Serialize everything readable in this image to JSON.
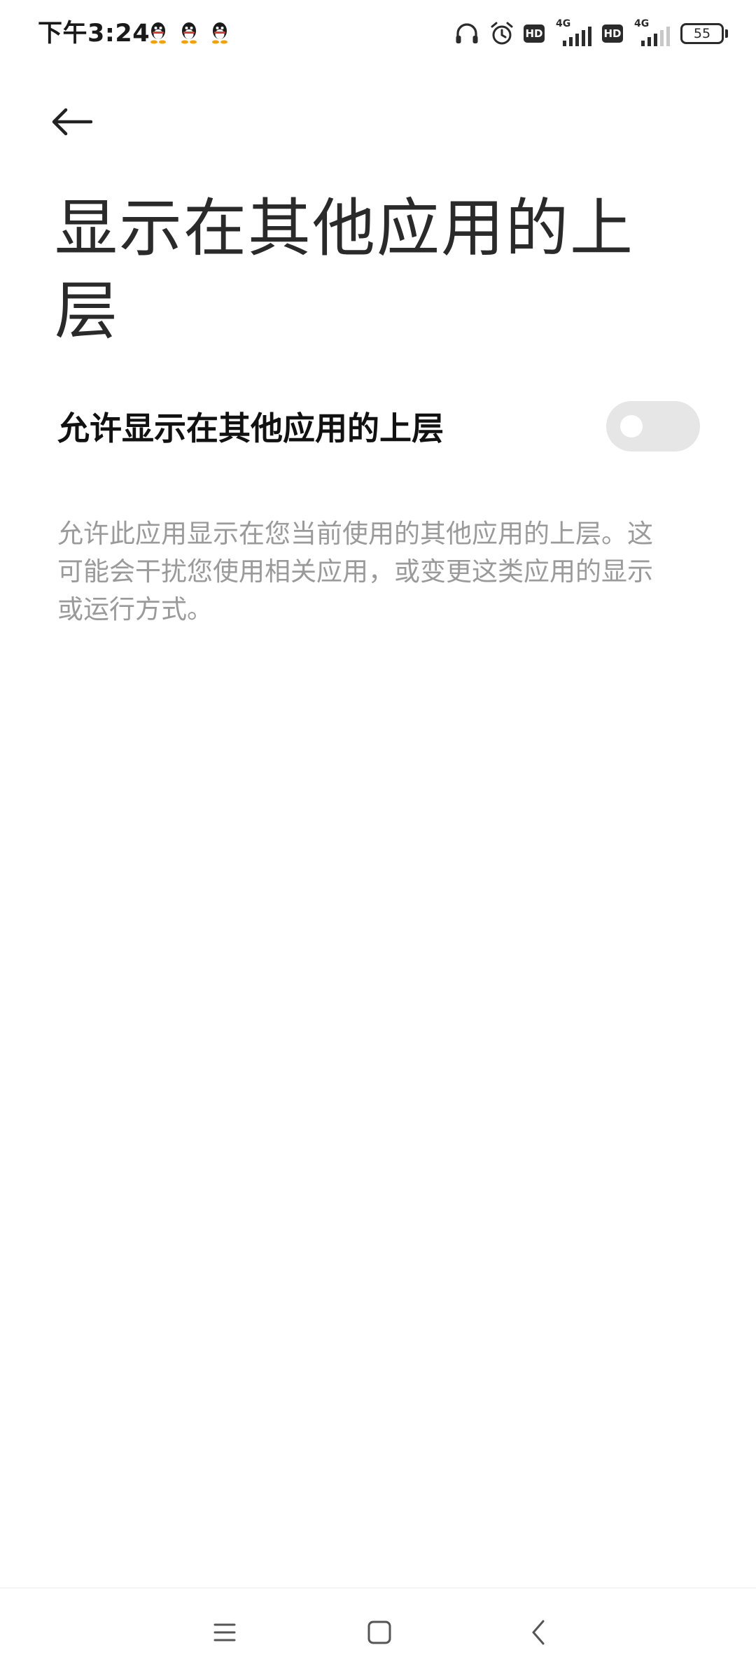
{
  "status_bar": {
    "time": "下午3:24",
    "notification_icons": [
      "qq-icon",
      "qq-icon",
      "qq-icon"
    ],
    "hd_label_1": "HD",
    "network_1": "4G",
    "hd_label_2": "HD",
    "network_2": "4G",
    "battery": "55"
  },
  "header": {
    "back_icon": "arrow-left-icon",
    "title": "显示在其他应用的上层"
  },
  "setting": {
    "label": "允许显示在其他应用的上层",
    "enabled": false
  },
  "description": "允许此应用显示在您当前使用的其他应用的上层。这可能会干扰您使用相关应用，或变更这类应用的显示或运行方式。",
  "nav_bar": {
    "icons": [
      "menu-icon",
      "home-icon",
      "back-icon"
    ]
  },
  "colors": {
    "background": "#ffffff",
    "title_text": "#2a2a2a",
    "label_text": "#111111",
    "description_text": "#9a9a9a",
    "toggle_off_track": "#e6e6e6",
    "toggle_knob": "#ffffff"
  }
}
